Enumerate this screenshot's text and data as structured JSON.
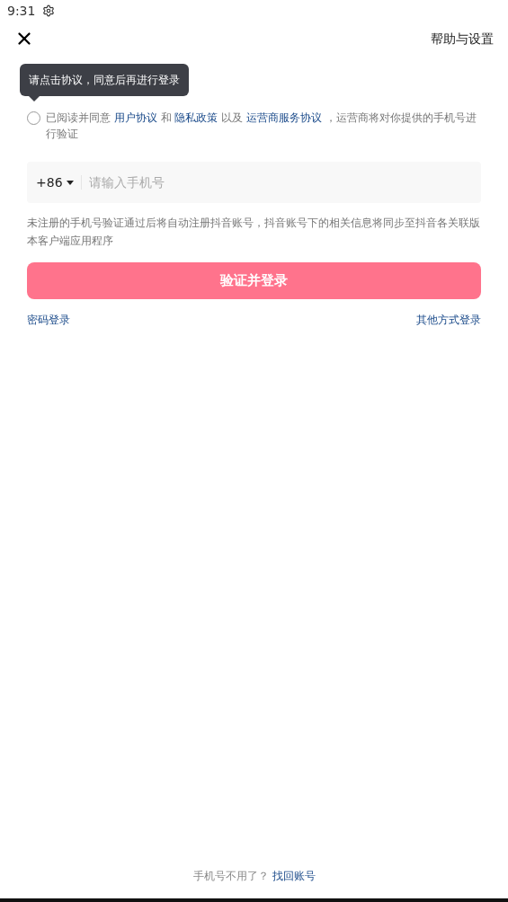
{
  "status_bar": {
    "time": "9:31"
  },
  "header": {
    "help": "帮助与设置"
  },
  "tooltip": "请点击协议，同意后再进行登录",
  "agreement": {
    "checked": false,
    "parts": [
      {
        "kind": "text",
        "text": "已阅读并同意 "
      },
      {
        "kind": "link",
        "text": "用户协议"
      },
      {
        "kind": "text",
        "text": " 和 "
      },
      {
        "kind": "link",
        "text": "隐私政策"
      },
      {
        "kind": "text",
        "text": " 以及 "
      },
      {
        "kind": "link",
        "text": "运营商服务协议"
      },
      {
        "kind": "text",
        "text": " ，运营商将对你提供的手机号进行验证"
      }
    ]
  },
  "phone": {
    "code": "+86",
    "placeholder": "请输入手机号"
  },
  "note": "未注册的手机号验证通过后将自动注册抖音账号，抖音账号下的相关信息将同步至抖音各关联版本客户端应用程序",
  "submit": "验证并登录",
  "links": [
    "密码登录",
    "其他方式登录"
  ],
  "footer": {
    "text": "手机号不用了？",
    "link": "找回账号"
  }
}
